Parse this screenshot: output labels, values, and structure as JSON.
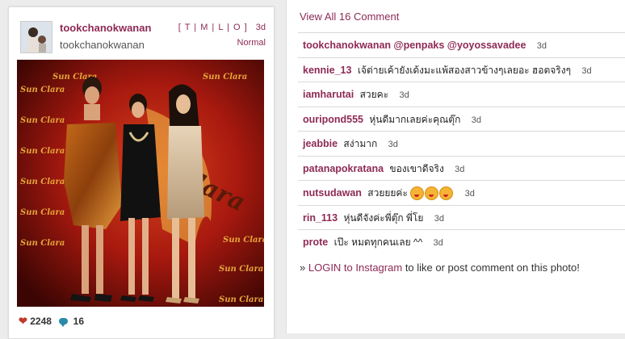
{
  "post": {
    "username": "tookchanokwanan",
    "full_name": "tookchanokwanan",
    "tlmo": "[ T | M | L | O ]",
    "age": "3d",
    "filter": "Normal",
    "likes": "2248",
    "comments_count": "16"
  },
  "panel": {
    "view_all": "View All 16 Comment",
    "comments": [
      {
        "user": "tookchanokwanan",
        "text": "@penpaks @yoyossavadee",
        "time": "3d",
        "bold_text": true
      },
      {
        "user": "kennie_13",
        "text": "เจ้ต่ายเค้ายังเด้งมะแพ้สองสาวข้างๆเลยอะ ฮอตจริงๆ",
        "time": "3d"
      },
      {
        "user": "iamharutai",
        "text": "สวยคะ",
        "time": "3d"
      },
      {
        "user": "ouripond555",
        "text": "หุ่นดีมากเลยค่ะคุณตุ๊ก",
        "time": "3d"
      },
      {
        "user": "jeabbie",
        "text": "สง่ามาก",
        "time": "3d"
      },
      {
        "user": "patanapokratana",
        "text": "ของเขาดีจริง",
        "time": "3d"
      },
      {
        "user": "nutsudawan",
        "text": "สวยยยค่ะ",
        "time": "3d",
        "emoji_count": 3
      },
      {
        "user": "rin_113",
        "text": "หุ่นดีจังค่ะพี่ตุ๊ก พี่โย",
        "time": "3d"
      },
      {
        "user": "prote",
        "text": "เป๊ะ หมดทุกคนเลย ^^",
        "time": "3d"
      }
    ],
    "login_prefix": "»",
    "login_link": "LOGIN to Instagram",
    "login_suffix": "to like or post comment on this photo!"
  },
  "colors": {
    "accent": "#8e2a55",
    "heart": "#c0392b",
    "comment_icon": "#2a8aa8"
  }
}
